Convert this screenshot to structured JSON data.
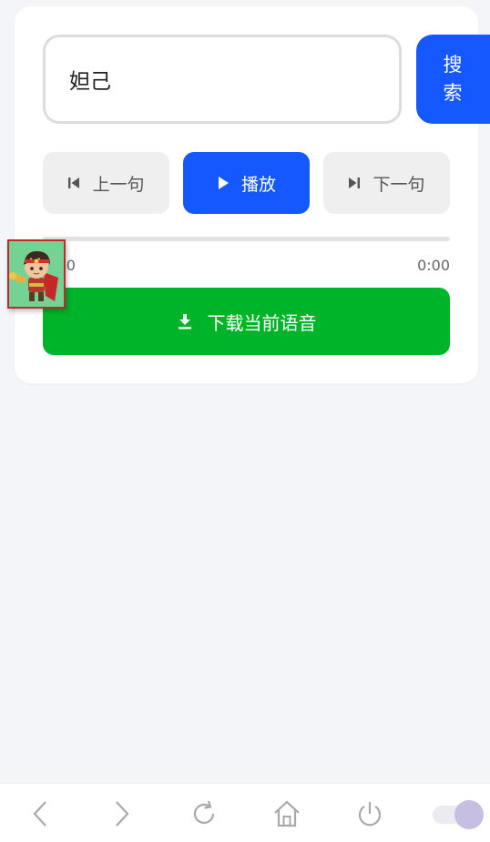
{
  "search": {
    "value": "妲己",
    "button_label_line1": "搜",
    "button_label_line2": "索"
  },
  "controls": {
    "prev_label": "上一句",
    "play_label": "播放",
    "next_label": "下一句"
  },
  "player": {
    "current_time": "0:00",
    "total_time": "0:00",
    "progress": 0
  },
  "download": {
    "label": "下载当前语音"
  },
  "colors": {
    "primary": "#1558ff",
    "download": "#00b42a",
    "background": "#f4f5f9"
  },
  "icons": {
    "prev": "skip-previous-icon",
    "play": "play-icon",
    "next": "skip-next-icon",
    "download": "download-icon",
    "back": "chevron-left-icon",
    "forward": "chevron-right-icon",
    "reload": "reload-icon",
    "home": "home-icon",
    "power": "power-icon"
  },
  "browser_toggle": {
    "state": "on"
  }
}
